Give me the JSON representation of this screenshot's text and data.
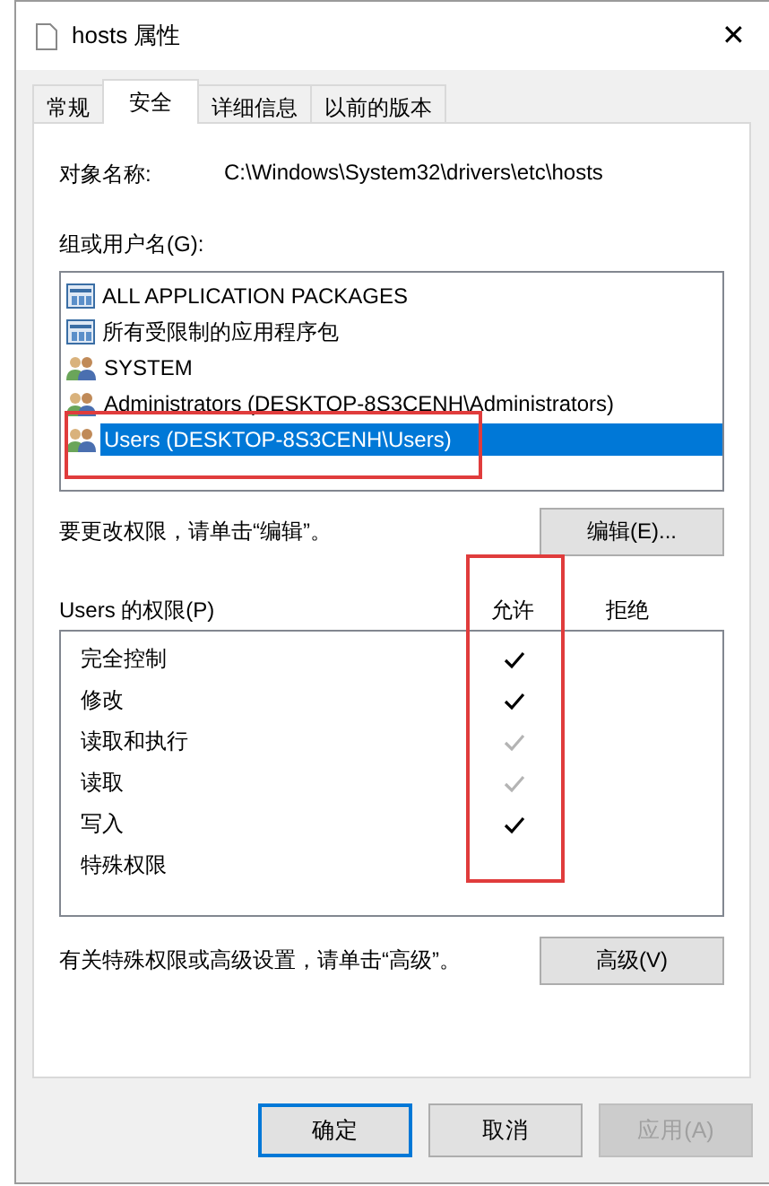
{
  "window": {
    "title": "hosts 属性",
    "close": "✕"
  },
  "tabs": [
    {
      "label": "常规",
      "selected": false
    },
    {
      "label": "安全",
      "selected": true
    },
    {
      "label": "详细信息",
      "selected": false
    },
    {
      "label": "以前的版本",
      "selected": false
    }
  ],
  "object_name": {
    "label": "对象名称:",
    "value": "C:\\Windows\\System32\\drivers\\etc\\hosts"
  },
  "groups": {
    "label": "组或用户名(G):",
    "items": [
      {
        "name": "ALL APPLICATION PACKAGES",
        "kind": "package",
        "selected": false,
        "highlighted": false
      },
      {
        "name": "所有受限制的应用程序包",
        "kind": "package",
        "selected": false,
        "highlighted": false
      },
      {
        "name": "SYSTEM",
        "kind": "users",
        "selected": false,
        "highlighted": false
      },
      {
        "name": "Administrators (DESKTOP-8S3CENH\\Administrators)",
        "kind": "users",
        "selected": false,
        "highlighted": false
      },
      {
        "name": "Users (DESKTOP-8S3CENH\\Users)",
        "kind": "users",
        "selected": true,
        "highlighted": true
      }
    ]
  },
  "edit_hint": "要更改权限，请单击“编辑”。",
  "edit_button": "编辑(E)...",
  "permissions": {
    "label": "Users 的权限(P)",
    "allow_header": "允许",
    "deny_header": "拒绝",
    "allow_highlighted": true,
    "rows": [
      {
        "name": "完全控制",
        "allow": true,
        "allow_disabled": false
      },
      {
        "name": "修改",
        "allow": true,
        "allow_disabled": false
      },
      {
        "name": "读取和执行",
        "allow": true,
        "allow_disabled": true
      },
      {
        "name": "读取",
        "allow": true,
        "allow_disabled": true
      },
      {
        "name": "写入",
        "allow": true,
        "allow_disabled": false
      },
      {
        "name": "特殊权限",
        "allow": false
      }
    ]
  },
  "advanced_hint": "有关特殊权限或高级设置，请单击“高级”。",
  "advanced_button": "高级(V)",
  "buttons": [
    {
      "label": "确定",
      "kind": "default",
      "disabled": false
    },
    {
      "label": "取消",
      "kind": "normal",
      "disabled": false
    },
    {
      "label": "应用(A)",
      "kind": "normal",
      "disabled": true
    }
  ]
}
